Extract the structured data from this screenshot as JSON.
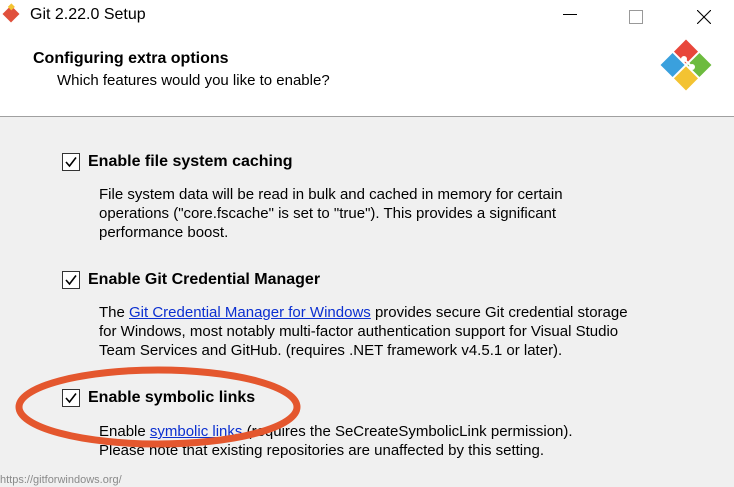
{
  "window": {
    "title": "Git 2.22.0 Setup"
  },
  "header": {
    "title": "Configuring extra options",
    "subtitle": "Which features would you like to enable?"
  },
  "options": [
    {
      "label": "Enable file system caching",
      "checked": true,
      "description_lines": [
        "File system data will be read in bulk and cached in memory for certain",
        "operations (\"core.fscache\" is set to \"true\"). This provides a significant",
        "performance boost."
      ]
    },
    {
      "label": "Enable Git Credential Manager",
      "checked": true,
      "description_prefix": "The ",
      "description_link": "Git Credential Manager for Windows",
      "description_suffix": " provides secure Git credential storage",
      "description_lines": [
        "for Windows, most notably multi-factor authentication support for Visual Studio",
        "Team Services and GitHub. (requires .NET framework v4.5.1 or later)."
      ]
    },
    {
      "label": "Enable symbolic links",
      "checked": true,
      "description_prefix": "Enable ",
      "description_link": "symbolic links",
      "description_suffix": " (requires the SeCreateSymbolicLink permission).",
      "description_lines": [
        "Please note that existing repositories are unaffected by this setting."
      ]
    }
  ],
  "status": {
    "url": "https://gitforwindows.org/"
  },
  "colors": {
    "annotation": "#e4572e",
    "link": "#0b2fd0",
    "background": "#f0f0f0"
  },
  "icons": {
    "app": "git-icon",
    "logo": "git-logo",
    "minimize": "minimize-icon",
    "maximize": "maximize-icon",
    "close": "close-icon",
    "check": "checkmark-icon"
  }
}
